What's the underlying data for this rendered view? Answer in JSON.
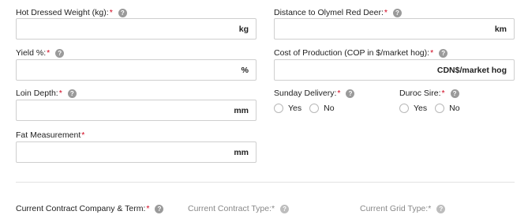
{
  "hot_dressed_weight": {
    "label": "Hot Dressed Weight (kg):",
    "required": "*",
    "help": "?",
    "unit": "kg",
    "value": ""
  },
  "distance": {
    "label": "Distance to Olymel Red Deer:",
    "required": "*",
    "help": "?",
    "unit": "km",
    "value": ""
  },
  "yield": {
    "label": "Yield %:",
    "required": "*",
    "help": "?",
    "unit": "%",
    "value": ""
  },
  "cost_of_production": {
    "label": "Cost of Production (COP in $/market hog):",
    "required": "*",
    "help": "?",
    "unit": "CDN$/market hog",
    "value": ""
  },
  "loin_depth": {
    "label": "Loin Depth:",
    "required": "*",
    "help": "?",
    "unit": "mm",
    "value": ""
  },
  "sunday_delivery": {
    "label": "Sunday Delivery:",
    "required": "*",
    "help": "?",
    "options": [
      "Yes",
      "No"
    ]
  },
  "duroc_sire": {
    "label": "Duroc Sire:",
    "required": "*",
    "help": "?",
    "options": [
      "Yes",
      "No"
    ]
  },
  "fat_measurement": {
    "label": "Fat Measurement",
    "required": "*",
    "unit": "mm",
    "value": ""
  },
  "current_contract_company": {
    "label": "Current Contract Company & Term:",
    "required": "*",
    "help": "?"
  },
  "current_contract_type": {
    "label": "Current Contract Type:",
    "required": "*",
    "help": "?"
  },
  "current_grid_type": {
    "label": "Current Grid Type:",
    "required": "*",
    "help": "?"
  }
}
